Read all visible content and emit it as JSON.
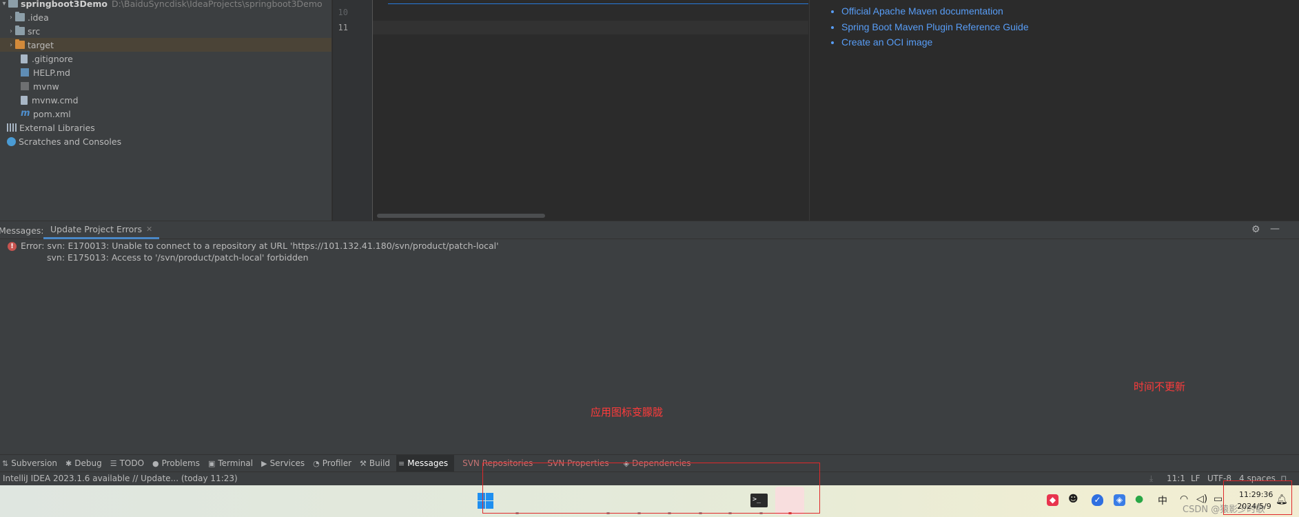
{
  "project": {
    "root_name": "springboot3Demo",
    "root_path": "D:\\BaiduSyncdisk\\IdeaProjects\\springboot3Demo",
    "items": [
      {
        "label": ".idea",
        "icon": "folder-icon",
        "expandable": true
      },
      {
        "label": "src",
        "icon": "folder-icon",
        "expandable": true
      },
      {
        "label": "target",
        "icon": "folder-orange-icon",
        "expandable": true
      },
      {
        "label": ".gitignore",
        "icon": "file-icon",
        "expandable": false
      },
      {
        "label": "HELP.md",
        "icon": "markdown-file-icon",
        "expandable": false
      },
      {
        "label": "mvnw",
        "icon": "script-file-icon",
        "expandable": false
      },
      {
        "label": "mvnw.cmd",
        "icon": "file-icon",
        "expandable": false
      },
      {
        "label": "pom.xml",
        "icon": "maven-file-icon",
        "expandable": false
      }
    ],
    "external_libraries": "External Libraries",
    "scratches": "Scratches and Consoles"
  },
  "editor": {
    "line_numbers": [
      "10",
      "11"
    ],
    "current_line": "11"
  },
  "preview": {
    "links": [
      "Official Apache Maven documentation",
      "Spring Boot Maven Plugin Reference Guide",
      "Create an OCI image"
    ]
  },
  "messages": {
    "title": "Messages:",
    "tab_label": "Update Project Errors",
    "error_line1": "Error: svn: E170013: Unable to connect to a repository at URL 'https://101.132.41.180/svn/product/patch-local'",
    "error_line2": "svn: E175013: Access to '/svn/product/patch-local' forbidden"
  },
  "annotations": {
    "time_not_updating": "时间不更新",
    "icons_blurry": "应用图标变朦胧"
  },
  "tool_tabs": [
    {
      "label": "Subversion",
      "icon": "subversion-icon"
    },
    {
      "label": "Debug",
      "icon": "bug-icon"
    },
    {
      "label": "TODO",
      "icon": "list-icon"
    },
    {
      "label": "Problems",
      "icon": "info-icon"
    },
    {
      "label": "Terminal",
      "icon": "terminal-icon"
    },
    {
      "label": "Services",
      "icon": "play-icon"
    },
    {
      "label": "Profiler",
      "icon": "profiler-icon"
    },
    {
      "label": "Build",
      "icon": "hammer-icon"
    },
    {
      "label": "Messages",
      "icon": "messages-icon",
      "active": true
    },
    {
      "label": "SVN Repositories",
      "icon": "",
      "svn": true
    },
    {
      "label": "SVN Properties",
      "icon": "",
      "svn": true
    },
    {
      "label": "Dependencies",
      "icon": "layers-icon",
      "svn": true
    }
  ],
  "status": {
    "text": "IntelliJ IDEA 2023.1.6 available // Update... (today 11:23)",
    "position": "11:1",
    "line_ending": "LF",
    "encoding": "UTF-8",
    "indent": "4 spaces"
  },
  "taskbar": {
    "clock_time": "11:29:36",
    "clock_date": "2024/5/9",
    "watermark": "CSDN @猿影少时歌",
    "terminal_glyph": ">_"
  },
  "colors": {
    "accent_blue": "#4a88c7",
    "link_blue": "#589df6",
    "annotation_red": "#ff3b3b",
    "selection": "#4b4437"
  }
}
